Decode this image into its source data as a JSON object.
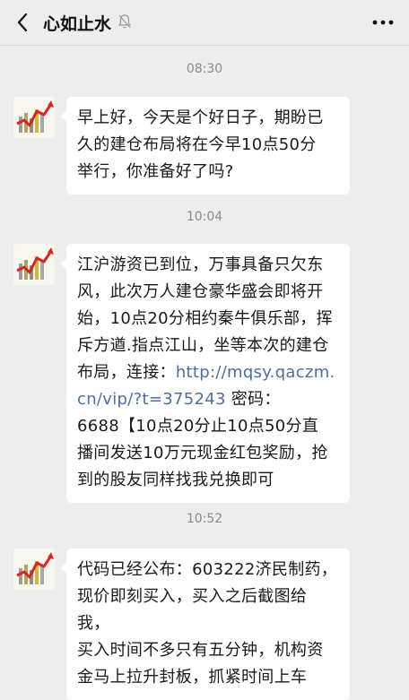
{
  "header": {
    "title": "心如止水",
    "back_icon": "chevron-left-icon",
    "mute_icon": "bell-off-icon",
    "more_icon": "more-dots-icon"
  },
  "messages": [
    {
      "time": "08:30",
      "avatar_icon": "stock-chart-avatar",
      "lines": [
        "早上好，今天是个好日子，期盼已",
        "久的建仓布局将在今早10点50分",
        "举行，你准备好了吗?"
      ]
    },
    {
      "time": "10:04",
      "avatar_icon": "stock-chart-avatar",
      "line1": "江沪游资已到位，万事具备只欠东",
      "line2": "风，此次万人建仓豪华盛会即将开",
      "line3": "始，10点20分相约秦牛俱乐部，挥",
      "line4": "斥方遒.指点江山，坐等本次的建仓",
      "line5_prefix": "布局，连接：",
      "link_part1": "http://mqsy.qaczm.",
      "link_part2": "cn/vip/?t=375243",
      "line6_suffix": " 密码：",
      "line7": "6688【10点20分止10点50分直",
      "line8": "播间发送10万元现金红包奖励，抢",
      "line9": "到的股友同样找我兑换即可"
    },
    {
      "time": "10:52",
      "avatar_icon": "stock-chart-avatar",
      "lines": [
        "代码已经公布：603222济民制药，",
        "现价即刻买入，买入之后截图给我，",
        "买入时间不多只有五分钟，机构资",
        "金马上拉升封板，抓紧时间上车"
      ]
    }
  ],
  "colors": {
    "background": "#ededed",
    "bubble": "#ffffff",
    "link": "#4a6fa5",
    "timestamp": "#8a8a8a"
  }
}
